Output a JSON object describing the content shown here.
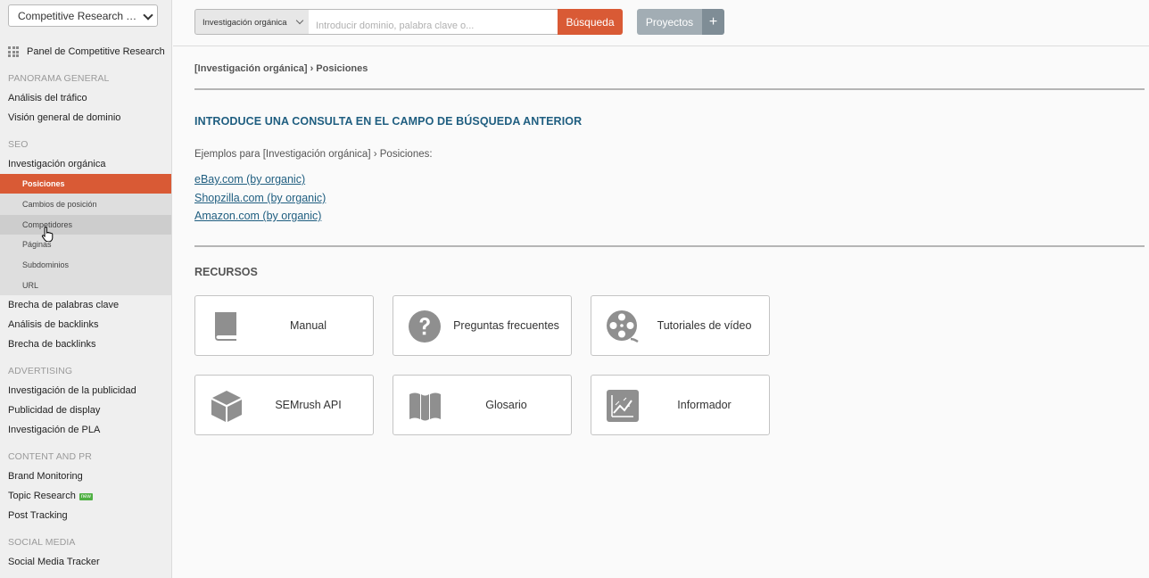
{
  "sidebar": {
    "tool_select": "Competitive Research To...",
    "panel_link": "Panel de Competitive Research",
    "sections": {
      "overview": {
        "title": "PANORAMA GENERAL",
        "items": [
          "Análisis del tráfico",
          "Visión general de dominio"
        ]
      },
      "seo": {
        "title": "SEO",
        "parent": "Investigación orgánica",
        "sub_items": [
          "Posiciones",
          "Cambios de posición",
          "Competidores",
          "Páginas",
          "Subdominios",
          "URL"
        ],
        "items_after": [
          "Brecha de palabras clave",
          "Análisis de backlinks",
          "Brecha de backlinks"
        ]
      },
      "advertising": {
        "title": "ADVERTISING",
        "items": [
          "Investigación de la publicidad",
          "Publicidad de display",
          "Investigación de PLA"
        ]
      },
      "content": {
        "title": "CONTENT AND PR",
        "items": [
          "Brand Monitoring",
          "Topic Research",
          "Post Tracking"
        ],
        "new_badge": "new"
      },
      "social": {
        "title": "SOCIAL MEDIA",
        "items": [
          "Social Media Tracker"
        ]
      }
    }
  },
  "topbar": {
    "database_select": "Investigación orgánica",
    "search_placeholder": "Introducir dominio, palabra clave o...",
    "search_button": "Búsqueda",
    "projects_button": "Proyectos",
    "add_button": "+"
  },
  "main": {
    "breadcrumb": "[Investigación orgánica] › Posiciones",
    "heading": "INTRODUCE UNA CONSULTA EN EL CAMPO DE BÚSQUEDA ANTERIOR",
    "examples_label": "Ejemplos para [Investigación orgánica] › Posiciones:",
    "examples": [
      "eBay.com (by organic)",
      "Shopzilla.com (by organic)",
      "Amazon.com (by organic)"
    ],
    "resources_title": "RECURSOS",
    "resources": [
      {
        "label": "Manual",
        "icon": "book-icon"
      },
      {
        "label": "Preguntas frecuentes",
        "icon": "question-icon"
      },
      {
        "label": "Tutoriales de vídeo",
        "icon": "film-reel-icon"
      },
      {
        "label": "SEMrush API",
        "icon": "cube-icon"
      },
      {
        "label": "Glosario",
        "icon": "map-icon"
      },
      {
        "label": "Informador",
        "icon": "chart-icon"
      }
    ]
  },
  "colors": {
    "accent": "#d95a35",
    "link": "#1f5e80",
    "icon_gray": "#8f8f8f",
    "new_badge": "#4fb043"
  }
}
